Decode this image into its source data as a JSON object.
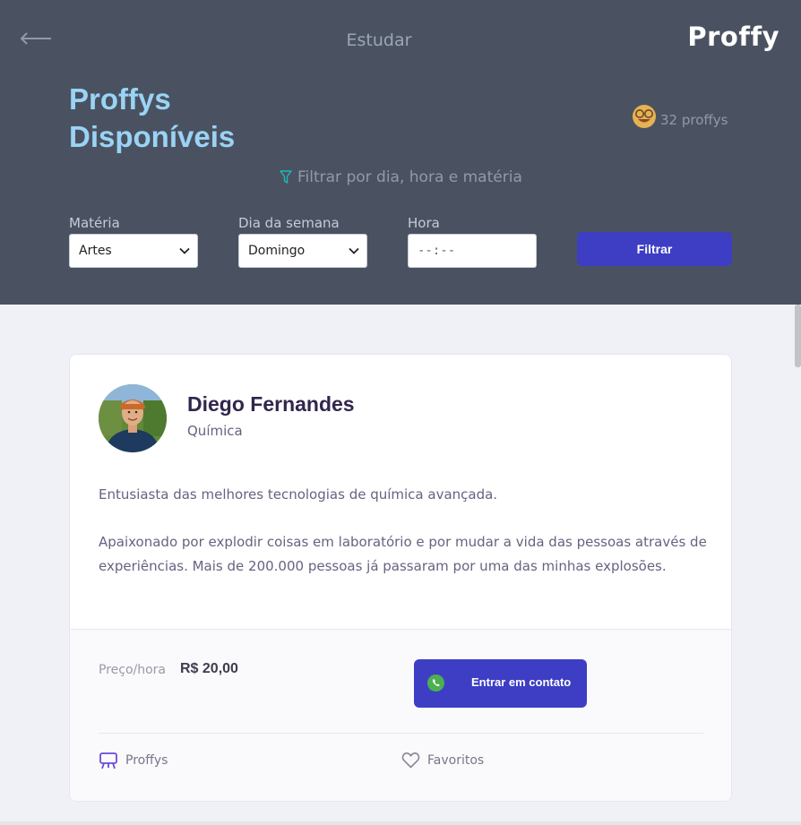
{
  "header": {
    "title": "Estudar",
    "logo": "Proffy",
    "heading_line1": "Proffys",
    "heading_line2": "Disponíveis",
    "count_text": "32 proffys",
    "filter_toggle": "Filtrar por dia, hora e matéria"
  },
  "filters": {
    "subject_label": "Matéria",
    "subject_value": "Artes",
    "weekday_label": "Dia da semana",
    "weekday_value": "Domingo",
    "time_label": "Hora",
    "time_value": "--:--",
    "submit_label": "Filtrar"
  },
  "teacher": {
    "name": "Diego Fernandes",
    "subject": "Química",
    "bio_paragraph_1": "Entusiasta das melhores tecnologias de química avançada.",
    "bio_paragraph_2": "Apaixonado por explodir coisas em laboratório e por mudar a vida das pessoas através de experiências. Mais de 200.000 pessoas já passaram por uma das minhas explosões.",
    "price_label": "Preço/hora",
    "price_value": "R$ 20,00",
    "contact_label": "Entrar em contato"
  },
  "footer_nav": {
    "proffys_label": "Proffys",
    "favorites_label": "Favoritos"
  },
  "colors": {
    "header_bg": "#4a5261",
    "accent": "#3d3ec4",
    "heading": "#9ad3f5",
    "page_bg": "#f0f0f7",
    "whatsapp": "#4caf50"
  },
  "icons": {
    "back": "arrow-left-icon",
    "count": "smiling-face-icon",
    "filter": "funnel-icon",
    "dropdown": "chevron-down-icon",
    "contact": "whatsapp-icon",
    "proffys": "presentation-board-icon",
    "favorites": "heart-icon"
  }
}
